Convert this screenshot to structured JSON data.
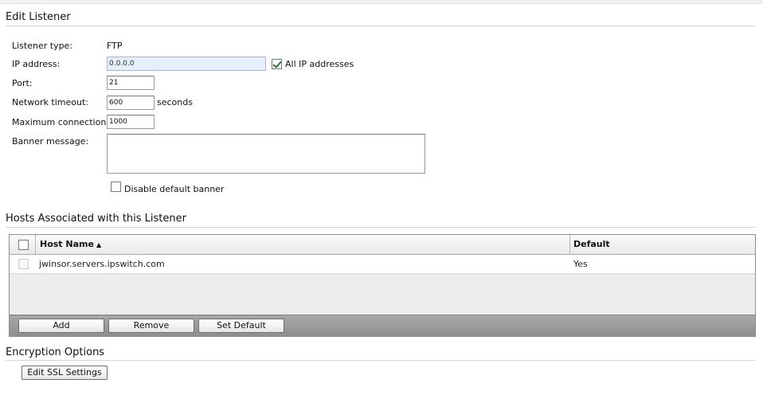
{
  "edit_listener": {
    "title": "Edit Listener",
    "listener_type_label": "Listener type:",
    "listener_type_value": "FTP",
    "ip_label": "IP address:",
    "ip_value": "0.0.0.0",
    "all_ip_label": "All IP addresses",
    "all_ip_checked": true,
    "port_label": "Port:",
    "port_value": "21",
    "timeout_label": "Network timeout:",
    "timeout_value": "600",
    "timeout_unit": "seconds",
    "max_conn_label": "Maximum connections:",
    "max_conn_value": "1000",
    "banner_label": "Banner message:",
    "banner_value": "",
    "disable_banner_label": "Disable default banner",
    "disable_banner_checked": false
  },
  "hosts": {
    "title": "Hosts Associated with this Listener",
    "columns": {
      "host_name": "Host Name",
      "sort_indicator": "▲",
      "default": "Default"
    },
    "rows": [
      {
        "host_name": "jwinsor.servers.ipswitch.com",
        "default": "Yes"
      }
    ],
    "buttons": {
      "add": "Add",
      "remove": "Remove",
      "set_default": "Set Default"
    }
  },
  "encryption": {
    "title": "Encryption Options",
    "ssl_button": "Edit SSL Settings"
  },
  "colors": {
    "check_green": "#2a7a2a",
    "disabled_input_bg": "#e4effb"
  }
}
